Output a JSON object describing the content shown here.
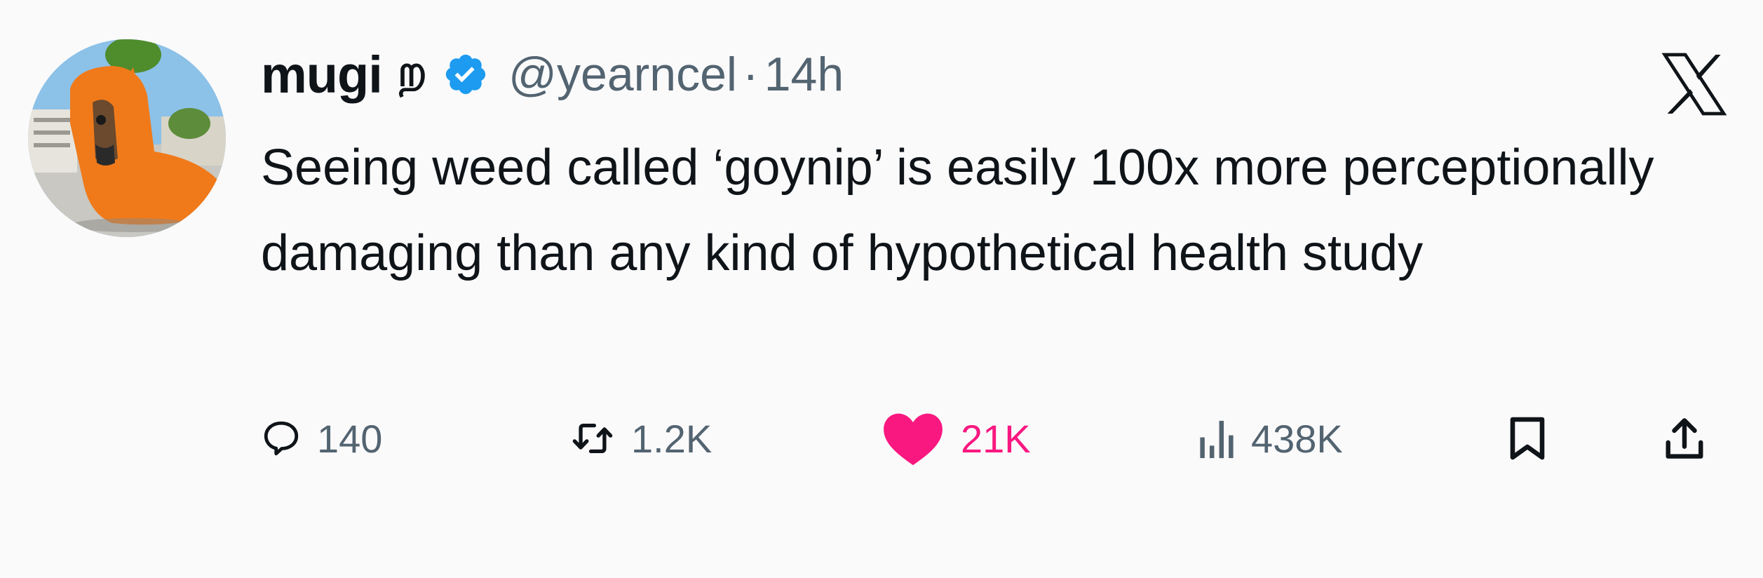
{
  "user": {
    "display_name": "mugi",
    "name_glyph": "ற",
    "handle": "@yearncel",
    "separator": "·",
    "timestamp": "14h",
    "verified_icon": "verified-badge-icon",
    "avatar_icon": "avatar-orange-costume-horse"
  },
  "platform": {
    "logo_icon": "x-logo-icon"
  },
  "tweet": {
    "text": "Seeing weed called ‘goynip’ is easily 100x more perceptionally damaging than any kind of hypothetical health study"
  },
  "actions": {
    "reply": {
      "icon": "reply-icon",
      "count": "140"
    },
    "retweet": {
      "icon": "retweet-icon",
      "count": "1.2K"
    },
    "like": {
      "icon": "heart-icon",
      "count": "21K",
      "active": true
    },
    "views": {
      "icon": "views-icon",
      "count": "438K"
    },
    "bookmark": {
      "icon": "bookmark-icon"
    },
    "share": {
      "icon": "share-icon"
    }
  },
  "colors": {
    "text": "#0f1419",
    "secondary": "#536471",
    "like": "#f91880",
    "verified": "#1d9bf0",
    "background": "#fbfafb"
  }
}
